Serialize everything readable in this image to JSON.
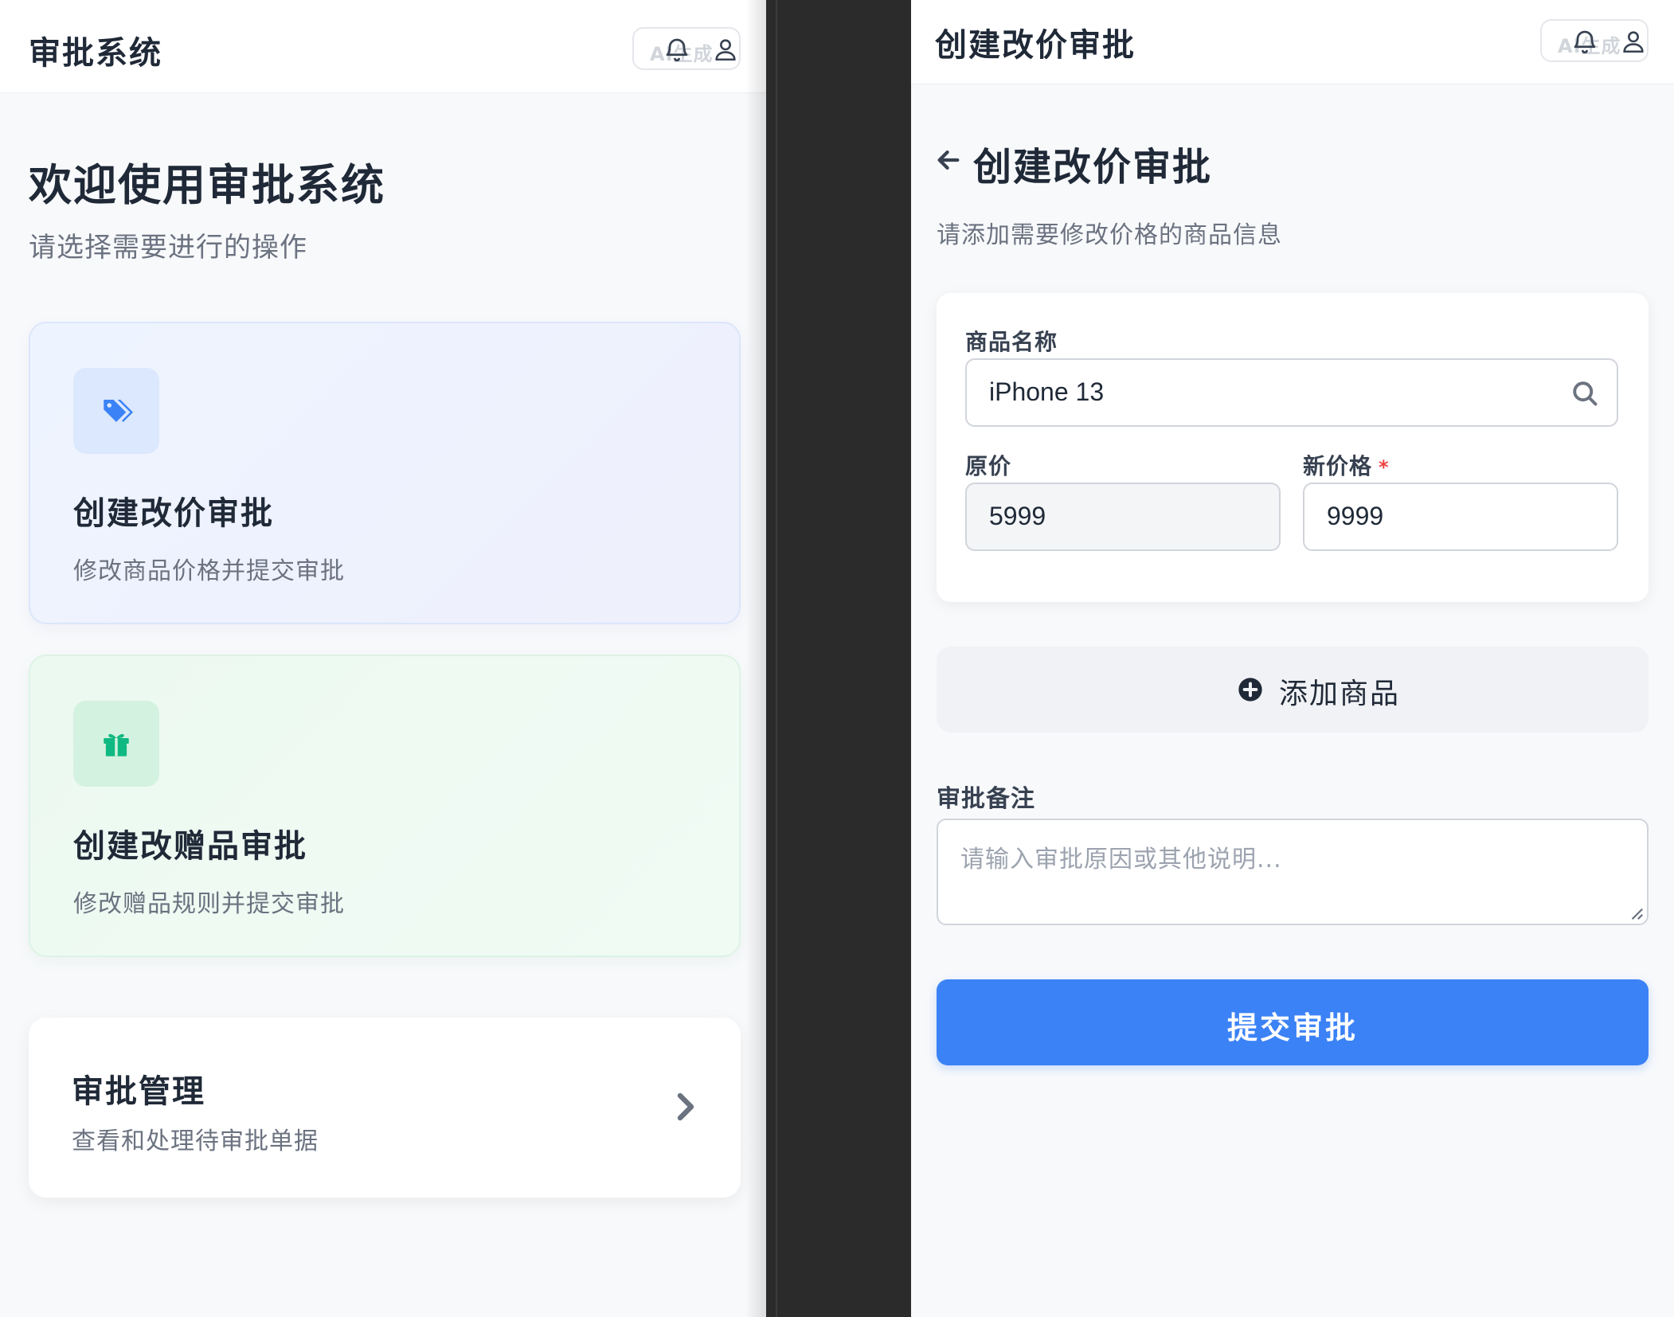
{
  "left": {
    "header": {
      "title": "审批系统",
      "ai_badge": "AI生成"
    },
    "welcome": {
      "title": "欢迎使用审批系统",
      "subtitle": "请选择需要进行的操作"
    },
    "cards": [
      {
        "title": "创建改价审批",
        "desc": "修改商品价格并提交审批",
        "icon": "tags-icon",
        "accent": "#3b82f6"
      },
      {
        "title": "创建改赠品审批",
        "desc": "修改赠品规则并提交审批",
        "icon": "gift-icon",
        "accent": "#10b981"
      }
    ],
    "manage": {
      "title": "审批管理",
      "desc": "查看和处理待审批单据"
    }
  },
  "right": {
    "header": {
      "title": "创建改价审批",
      "ai_badge": "AI生成"
    },
    "page_title": "创建改价审批",
    "page_subtitle": "请添加需要修改价格的商品信息",
    "product": {
      "name_label": "商品名称",
      "name_value": "iPhone 13",
      "orig_label": "原价",
      "orig_value": "5999",
      "new_label": "新价格",
      "required_mark": "*",
      "new_value": "9999"
    },
    "add_button": "添加商品",
    "remark": {
      "label": "审批备注",
      "placeholder": "请输入审批原因或其他说明..."
    },
    "submit_button": "提交审批"
  },
  "colors": {
    "primary": "#3b82f6",
    "gift": "#10b981",
    "required": "#ef4444"
  }
}
